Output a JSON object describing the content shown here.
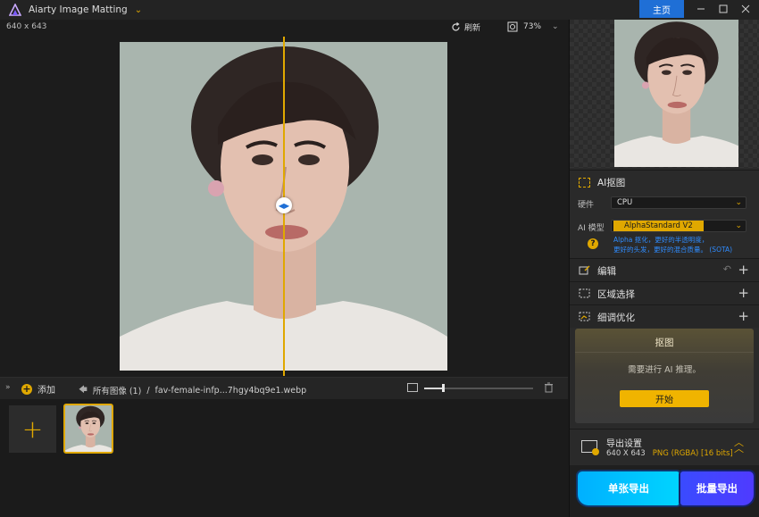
{
  "app": {
    "title": "Aiarty Image Matting",
    "home_label": "主页"
  },
  "canvas": {
    "dimensions": "640 x 643",
    "refresh_label": "刷新",
    "zoom": "73%"
  },
  "bottombar": {
    "add_label": "添加",
    "breadcrumb_all": "所有图像 (1)",
    "breadcrumb_sep": "/",
    "breadcrumb_file": "fav-female-infp...7hgy4bq9e1.webp",
    "thumb_size": 0.17
  },
  "panel": {
    "ai_section_title": "AI抠图",
    "hardware_label": "硬件",
    "hardware_value": "CPU",
    "model_label": "AI 模型",
    "model_value": "AlphaStandard  V2",
    "model_desc_line1": "Alpha 抠化，更好的半透明度，",
    "model_desc_line2": "更好的头发，更好的混合质量。 (SOTA)",
    "tools": [
      {
        "label": "编辑"
      },
      {
        "label": "区域选择"
      },
      {
        "label": "细调优化"
      }
    ],
    "matting_card": {
      "title": "抠图",
      "message": "需要进行 AI 推理。",
      "start_label": "开始"
    },
    "export_settings": {
      "title": "导出设置",
      "size": "640 X 643",
      "format": "PNG (RGBA) [16 bits]"
    },
    "export_single_label": "单张导出",
    "export_batch_label": "批量导出"
  },
  "colors": {
    "accent": "#e0a800",
    "home_blue": "#1f6fd6",
    "single_export": "#00c0ff",
    "batch_export": "#4545ff",
    "link_blue": "#2f8cff"
  }
}
